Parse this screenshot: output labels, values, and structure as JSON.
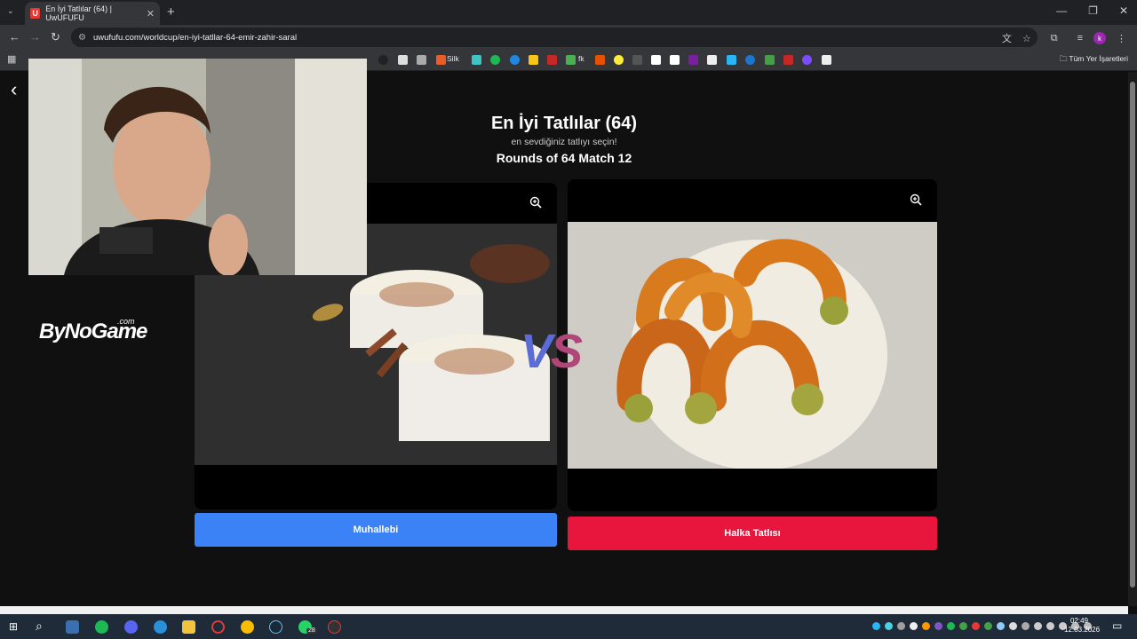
{
  "browser": {
    "tab_title": "En İyi Tatlılar (64) | UwUFUFU",
    "tab_favicon_letter": "U",
    "url": "uwufufu.com/worldcup/en-iyi-tatllar-64-emir-zahir-saral",
    "bookmarks": {
      "silk": "Silk",
      "fk": "fk",
      "all_bookmarks": "Tüm Yer İşaretleri"
    },
    "profile_initial": "k"
  },
  "page": {
    "title": "En İyi Tatlılar (64)",
    "subtitle": "en sevdiğiniz tatlıyı seçin!",
    "round": "Rounds of 64 Match 12",
    "vs_v": "V",
    "vs_s": "S",
    "left_choice": "Muhallebi",
    "right_choice": "Halka Tatlısı"
  },
  "overlay": {
    "sponsor_logo": "ByNoGame",
    "sponsor_logo_suffix": ".com"
  },
  "taskbar": {
    "time": "02:49",
    "date": "12.03.2026",
    "whatsapp_badge": "28"
  },
  "colors": {
    "left_button": "#3b82f6",
    "right_button": "#e8163c",
    "vs_v": "#5b6bd8",
    "vs_s": "#b14778"
  }
}
